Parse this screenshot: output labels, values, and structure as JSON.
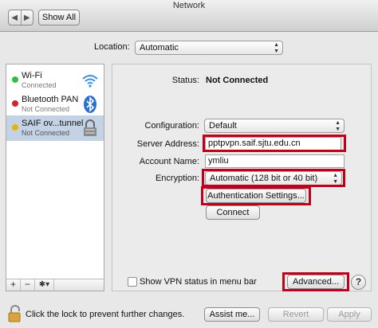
{
  "window": {
    "title": "Network"
  },
  "toolbar": {
    "back_glyph": "◀",
    "forward_glyph": "▶",
    "show_all_label": "Show All"
  },
  "location": {
    "label": "Location:",
    "value": "Automatic"
  },
  "services": [
    {
      "name": "Wi-Fi",
      "status": "Connected",
      "dot_color": "#2fbf3a",
      "icon": "wifi-icon"
    },
    {
      "name": "Bluetooth PAN",
      "status": "Not Connected",
      "dot_color": "#d0262a",
      "icon": "bluetooth-icon"
    },
    {
      "name": "SAIF ov...tunnel",
      "status": "Not Connected",
      "dot_color": "#e8b400",
      "icon": "vpn-lock-icon",
      "selected": true
    }
  ],
  "sidebar_controls": {
    "add": "+",
    "remove": "−",
    "gear": "✱▾"
  },
  "detail": {
    "status_label": "Status:",
    "status_value": "Not Connected",
    "configuration_label": "Configuration:",
    "configuration_value": "Default",
    "server_label": "Server Address:",
    "server_value": "pptpvpn.saif.sjtu.edu.cn",
    "account_label": "Account Name:",
    "account_value": "ymliu",
    "encryption_label": "Encryption:",
    "encryption_value": "Automatic (128 bit or 40 bit)",
    "auth_button": "Authentication Settings...",
    "connect_button": "Connect",
    "show_vpn_label": "Show VPN status in menu bar",
    "advanced_button": "Advanced...",
    "help_button": "?"
  },
  "footer": {
    "lock_text": "Click the lock to prevent further changes.",
    "assist_button": "Assist me...",
    "revert_button": "Revert",
    "apply_button": "Apply"
  },
  "colors": {
    "highlight": "#c0001a",
    "selected_row": "#c4d2e6"
  }
}
